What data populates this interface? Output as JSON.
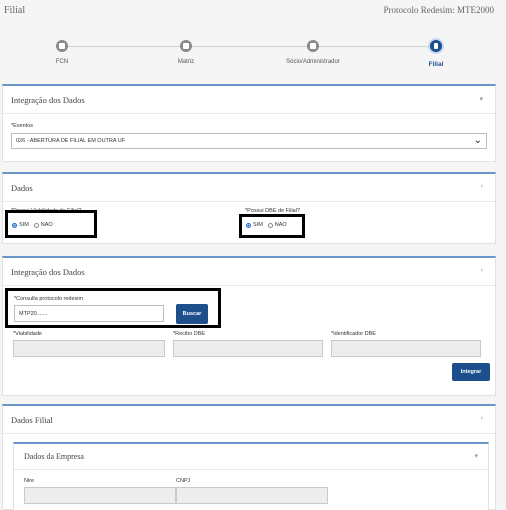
{
  "header": {
    "title": "Filial",
    "protocol": "Protocolo Redesim: MTE2000"
  },
  "stepper": {
    "steps": [
      {
        "label": "FCN",
        "active": false
      },
      {
        "label": "Matriz",
        "active": false
      },
      {
        "label": "Sócio/Administrador",
        "active": false
      },
      {
        "label": "Filial",
        "active": true
      }
    ]
  },
  "integracao1": {
    "title": "Integração dos Dados",
    "eventos_label": "*Eventos",
    "eventos_value": "026 - ABERTURA DE FILIAL EM OUTRA UF"
  },
  "dados": {
    "title": "Dados",
    "viabilidade_label": "*Possui Viabilidade de Filial?",
    "dbe_label": "*Possui DBE de Filial?",
    "sim": "SIM",
    "nao": "NAO"
  },
  "integracao2": {
    "title": "Integração dos Dados",
    "consulta_label": "*Consulta protocolo redesim",
    "consulta_value": "MTP20.......",
    "buscar": "Buscar",
    "viabilidade_label": "*Viabilidade",
    "recibo_label": "*Recibo DBE",
    "identificador_label": "*Identificador DBE",
    "integrar": "Integrar"
  },
  "dados_filial": {
    "title": "Dados Filial",
    "empresa_title": "Dados da Empresa",
    "nire_label": "Nire",
    "cnpj_label": "CNPJ"
  },
  "colors": {
    "accent": "#1d4f8d",
    "panel_border": "#6a96c8",
    "radio": "#1d6fd1"
  },
  "icons": {
    "chevron": "chevron-down-icon",
    "collapse": "collapse-icon",
    "step": "document-icon"
  }
}
